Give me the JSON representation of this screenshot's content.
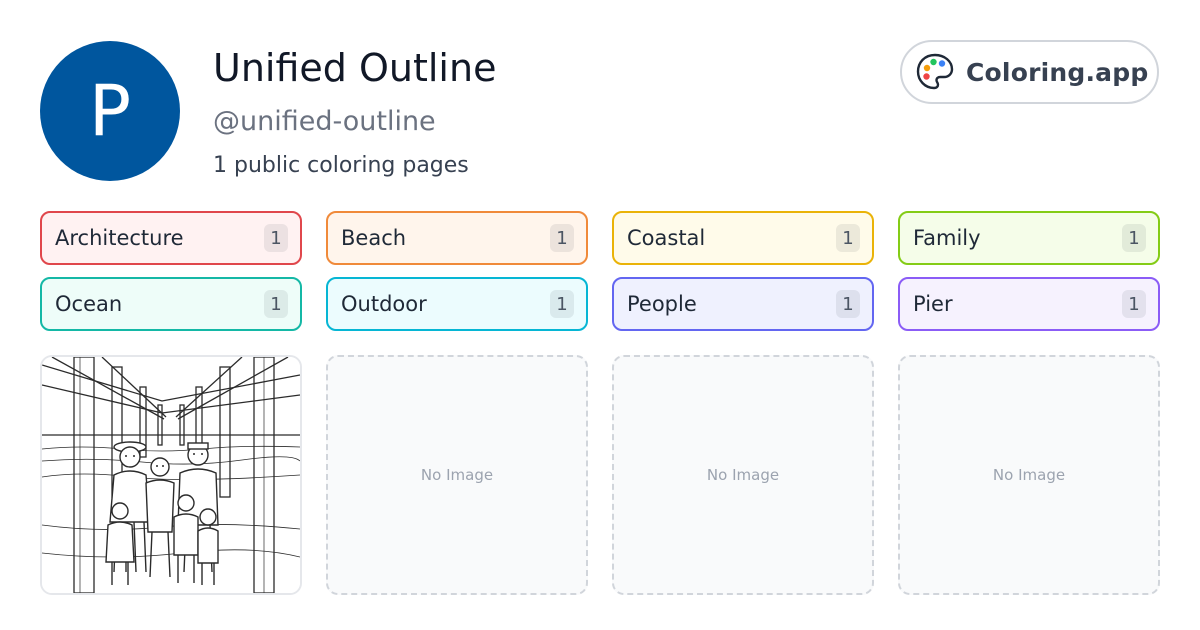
{
  "profile": {
    "initial": "P",
    "name": "Unified Outline",
    "handle": "@unified-outline",
    "page_count_text": "1 public coloring pages",
    "avatar_color": "#00569e"
  },
  "brand": {
    "label": "Coloring.app",
    "icon": "palette-icon"
  },
  "tags": [
    {
      "label": "Architecture",
      "count": "1",
      "border": "#e0474c",
      "bg": "#fff2f2"
    },
    {
      "label": "Beach",
      "count": "1",
      "border": "#f08a3a",
      "bg": "#fff5ec"
    },
    {
      "label": "Coastal",
      "count": "1",
      "border": "#eab308",
      "bg": "#fffbea"
    },
    {
      "label": "Family",
      "count": "1",
      "border": "#84cc16",
      "bg": "#f5fde9"
    },
    {
      "label": "Ocean",
      "count": "1",
      "border": "#14b8a6",
      "bg": "#eefdf9"
    },
    {
      "label": "Outdoor",
      "count": "1",
      "border": "#06b6d4",
      "bg": "#ecfcfe"
    },
    {
      "label": "People",
      "count": "1",
      "border": "#6366f1",
      "bg": "#eff1fe"
    },
    {
      "label": "Pier",
      "count": "1",
      "border": "#8b5cf6",
      "bg": "#f6f2fe"
    }
  ],
  "cards": [
    {
      "type": "image",
      "alt": "Family under pier coloring page"
    },
    {
      "type": "empty",
      "label": "No Image"
    },
    {
      "type": "empty",
      "label": "No Image"
    },
    {
      "type": "empty",
      "label": "No Image"
    }
  ]
}
